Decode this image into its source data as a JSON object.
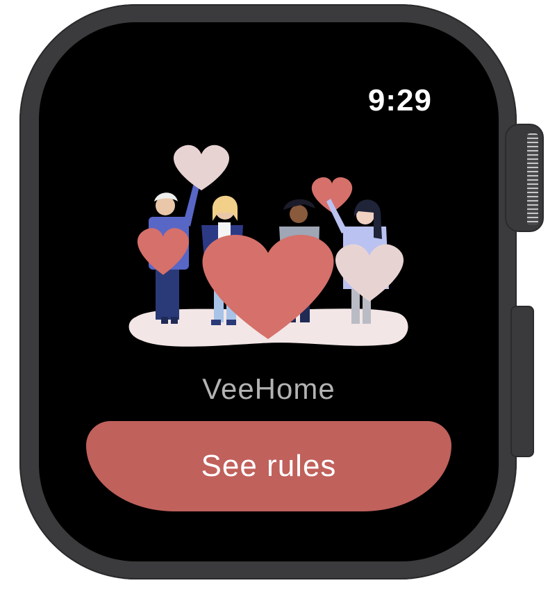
{
  "status_bar": {
    "time": "9:29"
  },
  "app": {
    "name": "VeeHome"
  },
  "actions": {
    "primary_label": "See rules"
  },
  "colors": {
    "screen_background": "#000000",
    "case": "#3b3b3d",
    "button": "#c0615c",
    "heart_primary": "#d6706a",
    "heart_light": "#e8d3d3",
    "app_name_text": "#b3b3b3"
  },
  "illustration": {
    "icon": "people-holding-hearts-illustration"
  }
}
